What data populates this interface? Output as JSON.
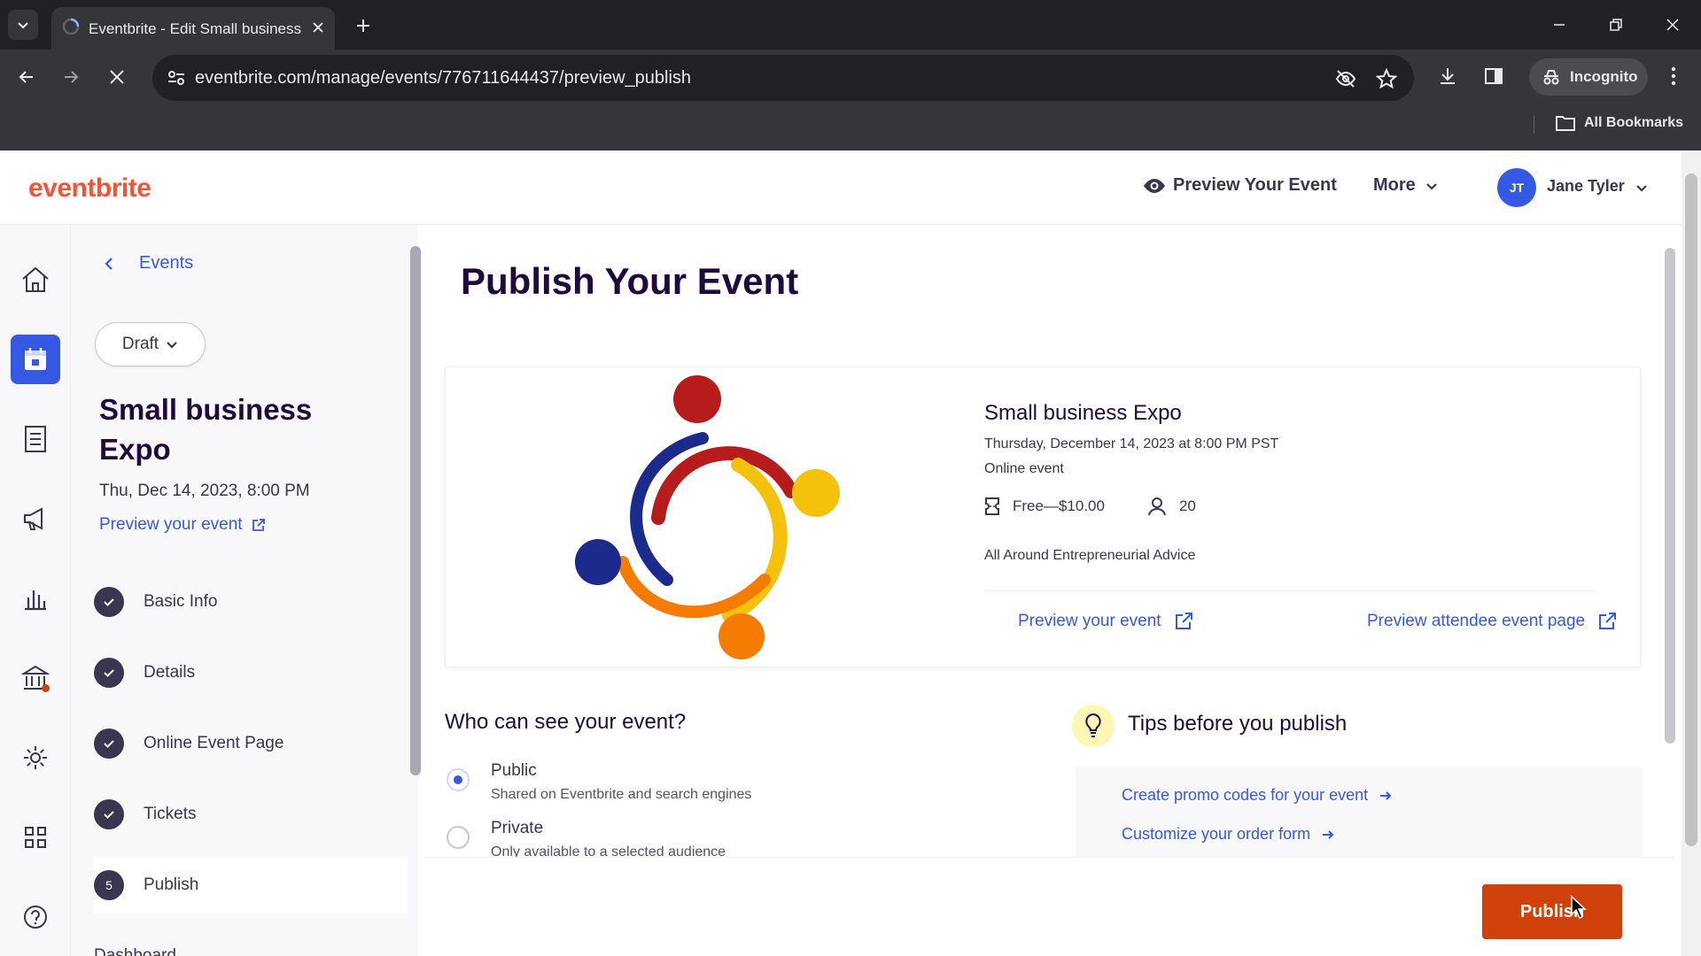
{
  "browser": {
    "tab_title": "Eventbrite - Edit Small business Expo",
    "url": "eventbrite.com/manage/events/776711644437/preview_publish",
    "incognito_label": "Incognito",
    "bookmarks_label": "All Bookmarks"
  },
  "header": {
    "logo": "eventbrite",
    "preview_label": "Preview Your Event",
    "more_label": "More",
    "user_initials": "JT",
    "user_name": "Jane Tyler"
  },
  "sidebar": {
    "back_label": "Events",
    "status": "Draft",
    "event_title": "Small business Expo",
    "event_date": "Thu, Dec 14, 2023, 8:00 PM",
    "preview_link": "Preview your event",
    "steps": [
      {
        "label": "Basic Info",
        "state": "done"
      },
      {
        "label": "Details",
        "state": "done"
      },
      {
        "label": "Online Event Page",
        "state": "done"
      },
      {
        "label": "Tickets",
        "state": "done"
      },
      {
        "label": "Publish",
        "state": "current",
        "number": "5"
      }
    ],
    "next_section": "Dashboard"
  },
  "main": {
    "title": "Publish Your Event",
    "card": {
      "name": "Small business Expo",
      "datetime": "Thursday, December 14, 2023 at 8:00 PM PST",
      "type": "Online event",
      "price": "Free—$10.00",
      "capacity": "20",
      "organizer": "All Around Entrepreneurial Advice",
      "preview_event_link": "Preview your event",
      "preview_attendee_link": "Preview attendee event page"
    },
    "visibility": {
      "title": "Who can see your event?",
      "options": [
        {
          "label": "Public",
          "desc": "Shared on Eventbrite and search engines",
          "selected": true
        },
        {
          "label": "Private",
          "desc": "Only available to a selected audience",
          "selected": false
        }
      ]
    },
    "tips": {
      "title": "Tips before you publish",
      "links": [
        "Create promo codes for your event",
        "Customize your order form"
      ]
    },
    "publish_button": "Publish"
  },
  "colors": {
    "brand_orange": "#f05537",
    "primary_blue": "#3659e3",
    "publish_red": "#d1410c",
    "heading": "#1e0a3c"
  }
}
